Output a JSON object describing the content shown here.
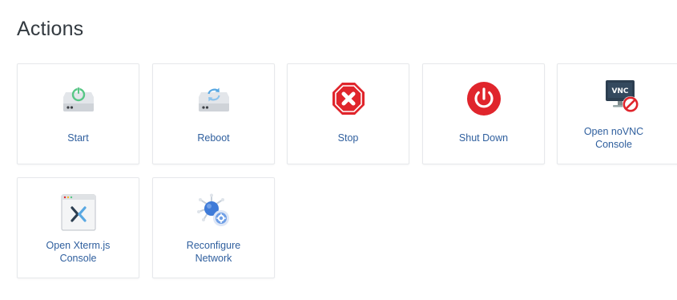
{
  "page": {
    "title": "Actions"
  },
  "actions": [
    {
      "line1": "Start",
      "line2": ""
    },
    {
      "line1": "Reboot",
      "line2": ""
    },
    {
      "line1": "Stop",
      "line2": ""
    },
    {
      "line1": "Shut Down",
      "line2": ""
    },
    {
      "line1": "Open noVNC",
      "line2": "Console"
    },
    {
      "line1": "Open Xterm.js",
      "line2": "Console"
    },
    {
      "line1": "Reconfigure",
      "line2": "Network"
    }
  ],
  "icons": {
    "start": "server-power-icon",
    "reboot": "server-reboot-icon",
    "stop": "stop-octagon-icon",
    "shutdown": "power-button-icon",
    "vnc": "vnc-monitor-icon",
    "vnc_badge_text": "VNC",
    "xterm": "xterm-window-icon",
    "network": "network-config-icon"
  },
  "colors": {
    "link": "#2f5f9e",
    "stop_red": "#e0252c",
    "power_green": "#57c785",
    "reboot_blue": "#59a8e2",
    "network_blue": "#3f7bd8"
  }
}
